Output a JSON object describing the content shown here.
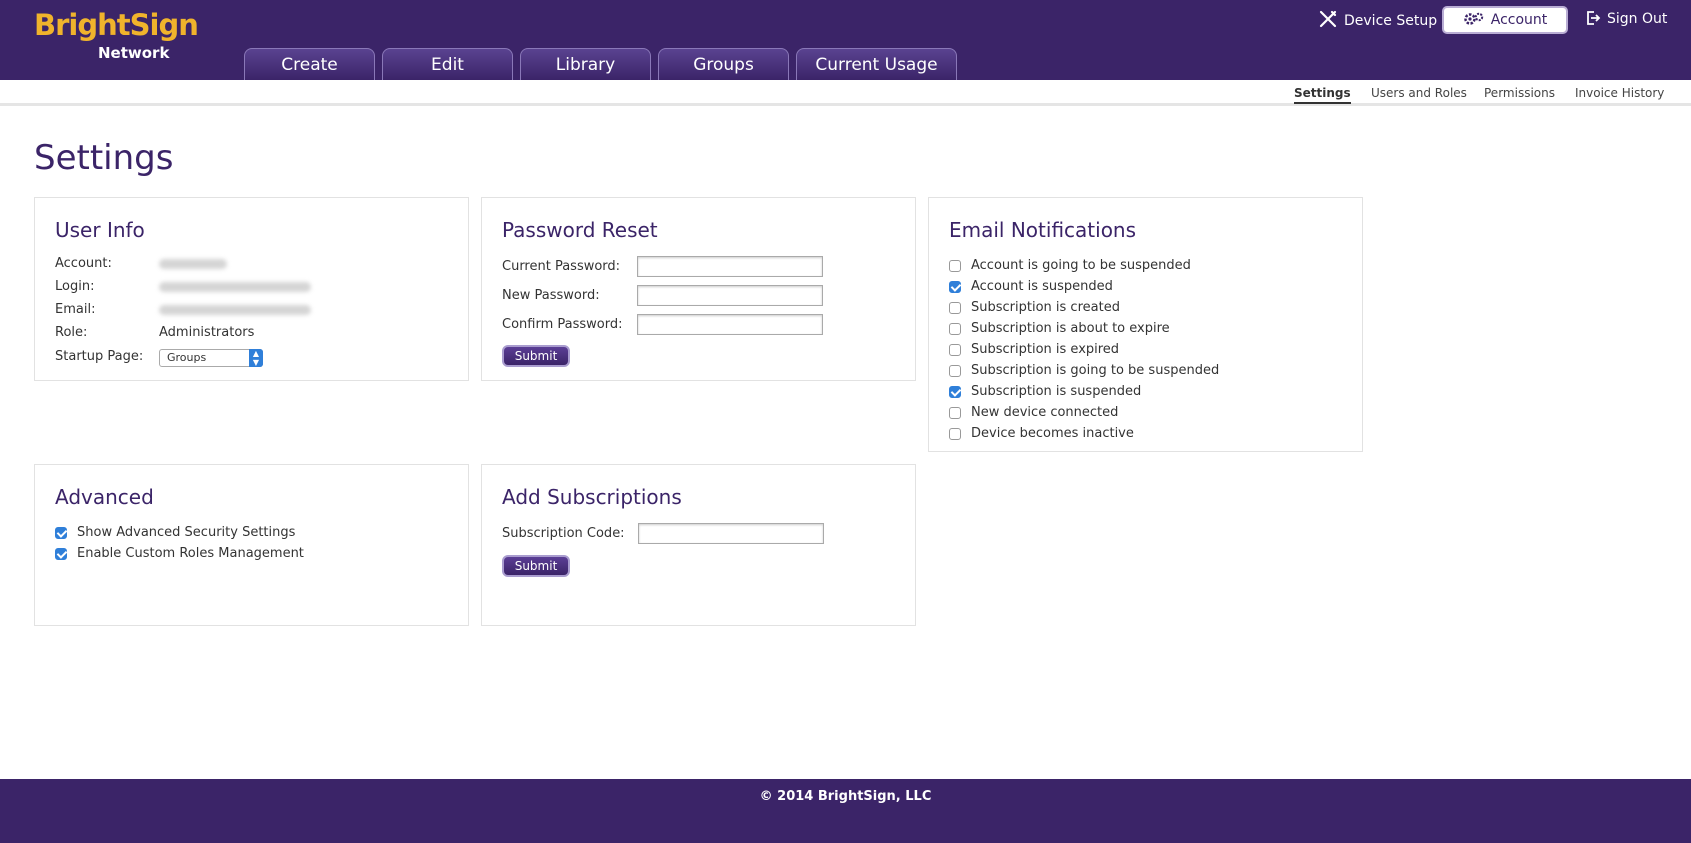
{
  "header": {
    "logo_brand": "BrightSign",
    "logo_sub": "Network",
    "tabs": [
      "Create",
      "Edit",
      "Library",
      "Groups",
      "Current Usage"
    ],
    "device_setup": "Device Setup",
    "account": "Account",
    "sign_out": "Sign Out"
  },
  "subnav": {
    "items": [
      "Settings",
      "Users and Roles",
      "Permissions",
      "Invoice History"
    ],
    "active": "Settings"
  },
  "page_title": "Settings",
  "user_info": {
    "title": "User Info",
    "account_label": "Account:",
    "login_label": "Login:",
    "email_label": "Email:",
    "role_label": "Role:",
    "role_value": "Administrators",
    "startup_label": "Startup Page:",
    "startup_value": "Groups"
  },
  "password_reset": {
    "title": "Password Reset",
    "current_label": "Current Password:",
    "new_label": "New Password:",
    "confirm_label": "Confirm Password:",
    "submit": "Submit"
  },
  "email_notifications": {
    "title": "Email Notifications",
    "items": [
      {
        "label": "Account is going to be suspended",
        "checked": false
      },
      {
        "label": "Account is suspended",
        "checked": true
      },
      {
        "label": "Subscription is created",
        "checked": false
      },
      {
        "label": "Subscription is about to expire",
        "checked": false
      },
      {
        "label": "Subscription is expired",
        "checked": false
      },
      {
        "label": "Subscription is going to be suspended",
        "checked": false
      },
      {
        "label": "Subscription is suspended",
        "checked": true
      },
      {
        "label": "New device connected",
        "checked": false
      },
      {
        "label": "Device becomes inactive",
        "checked": false
      }
    ]
  },
  "advanced": {
    "title": "Advanced",
    "items": [
      {
        "label": "Show Advanced Security Settings",
        "checked": true
      },
      {
        "label": "Enable Custom Roles Management",
        "checked": true
      }
    ]
  },
  "add_subscriptions": {
    "title": "Add Subscriptions",
    "code_label": "Subscription Code:",
    "submit": "Submit"
  },
  "footer": {
    "copyright": "© 2014 BrightSign, LLC"
  },
  "colors": {
    "brand_purple": "#3b2468",
    "logo_gold": "#f0b32c",
    "checkbox_blue": "#2f7fd9"
  },
  "icons": [
    "tools-icon",
    "gear-icon",
    "sign-out-icon",
    "chevron-updown-icon",
    "checkmark-icon"
  ]
}
